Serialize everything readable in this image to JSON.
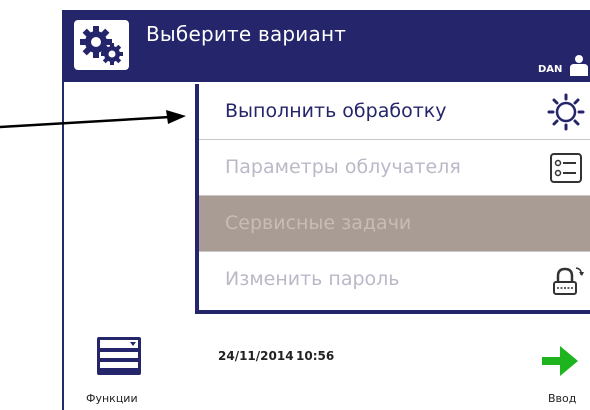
{
  "header": {
    "title": "Выберите вариант",
    "user": "DAN",
    "color": "#25256b"
  },
  "menu": {
    "items": [
      {
        "label": "Выполнить обработку",
        "icon": "sun-icon",
        "state": "enabled"
      },
      {
        "label": "Параметры облучателя",
        "icon": "settings-list-icon",
        "state": "disabled"
      },
      {
        "label": "Сервисные задачи",
        "icon": "",
        "state": "highlighted-disabled"
      },
      {
        "label": "Изменить пароль",
        "icon": "lock-icon",
        "state": "disabled"
      }
    ]
  },
  "footer": {
    "functions_label": "Функции",
    "date": "24/11/2014",
    "time": "10:56",
    "enter_label": "Ввод"
  },
  "colors": {
    "accent": "#25256b",
    "highlight": "#a89c94",
    "enter_arrow": "#1db41d"
  }
}
